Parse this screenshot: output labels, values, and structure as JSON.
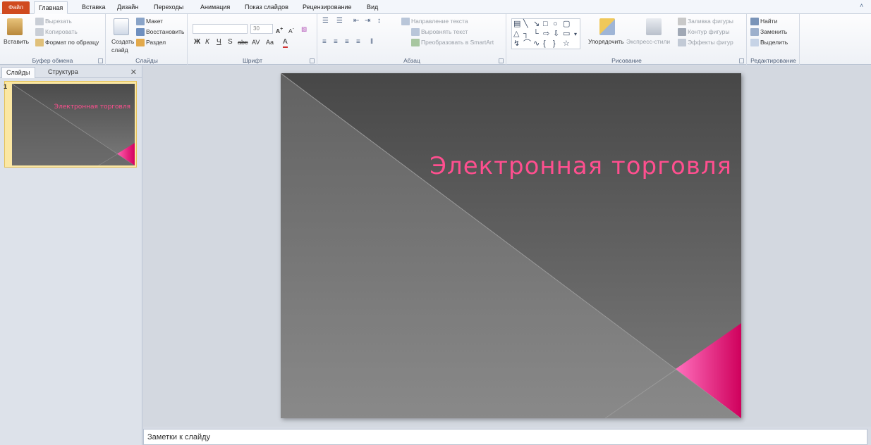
{
  "tabs": [
    {
      "label": "Файл"
    },
    {
      "label": "Главная"
    },
    {
      "label": "Вставка"
    },
    {
      "label": "Дизайн"
    },
    {
      "label": "Переходы"
    },
    {
      "label": "Анимация"
    },
    {
      "label": "Показ слайдов"
    },
    {
      "label": "Рецензирование"
    },
    {
      "label": "Вид"
    }
  ],
  "clipboard": {
    "paste": "Вставить",
    "cut": "Вырезать",
    "copy": "Копировать",
    "format_painter": "Формат по образцу",
    "group": "Буфер обмена"
  },
  "slides_group": {
    "new_slide_line1": "Создать",
    "new_slide_line2": "слайд",
    "layout": "Макет",
    "reset": "Восстановить",
    "section": "Раздел",
    "group": "Слайды"
  },
  "font": {
    "size": "30",
    "group": "Шрифт"
  },
  "paragraph": {
    "text_direction": "Направление текста",
    "align_text": "Выровнять текст",
    "smartart": "Преобразовать в SmartArt",
    "group": "Абзац"
  },
  "drawing": {
    "arrange": "Упорядочить",
    "quick_styles": "Экспресс-стили",
    "shape_fill": "Заливка фигуры",
    "shape_outline": "Контур фигуры",
    "shape_effects": "Эффекты фигур",
    "group": "Рисование"
  },
  "editing": {
    "find": "Найти",
    "replace": "Заменить",
    "select": "Выделить",
    "group": "Редактирование"
  },
  "pane": {
    "tab_slides": "Слайды",
    "tab_outline": "Структура",
    "slide_number": "1"
  },
  "slide": {
    "title": "Электронная торговля"
  },
  "notes": {
    "placeholder": "Заметки к слайду"
  },
  "colors": {
    "accent": "#ff4f8f",
    "file_tab": "#d04a1f",
    "triangle": "#e6006f"
  }
}
